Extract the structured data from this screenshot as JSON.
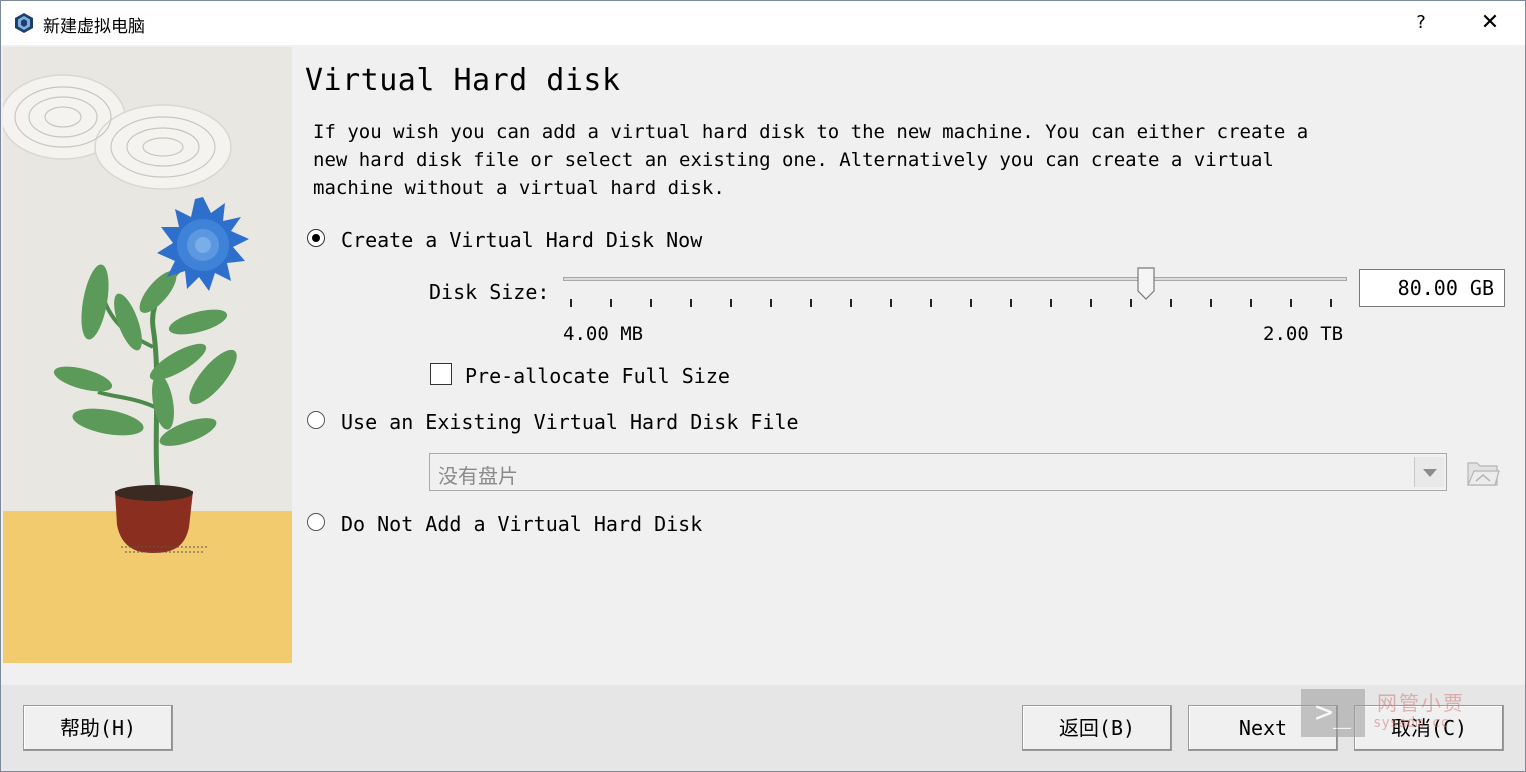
{
  "window": {
    "title": "新建虚拟电脑",
    "help_glyph": "?",
    "close_glyph": "✕"
  },
  "page": {
    "heading": "Virtual Hard disk",
    "description": "If you wish you can add a virtual hard disk to the new machine. You can either create a\nnew hard disk file or select an existing one. Alternatively you can create a virtual\nmachine without a virtual hard disk."
  },
  "options": {
    "create_now": {
      "label": "Create a Virtual Hard Disk Now",
      "selected": true
    },
    "use_existing": {
      "label": "Use an Existing Virtual Hard Disk File",
      "selected": false
    },
    "do_not_add": {
      "label": "Do Not Add a Virtual Hard Disk",
      "selected": false
    }
  },
  "disk_size": {
    "label": "Disk Size:",
    "value": "80.00 GB",
    "min_label": "4.00 MB",
    "max_label": "2.00 TB"
  },
  "preallocate": {
    "label": "Pre-allocate Full Size",
    "checked": false
  },
  "existing_disk": {
    "selected": "没有盘片"
  },
  "buttons": {
    "help": "帮助(H)",
    "back": "返回(B)",
    "next": "Next",
    "cancel": "取消(C)"
  },
  "watermark": {
    "glyph": ">_",
    "text": "网管小贾",
    "subtext": "sysadm.cc"
  },
  "icons": {
    "app": "virtualbox-icon",
    "folder": "folder-open-icon",
    "dropdown": "chevron-down-icon"
  }
}
